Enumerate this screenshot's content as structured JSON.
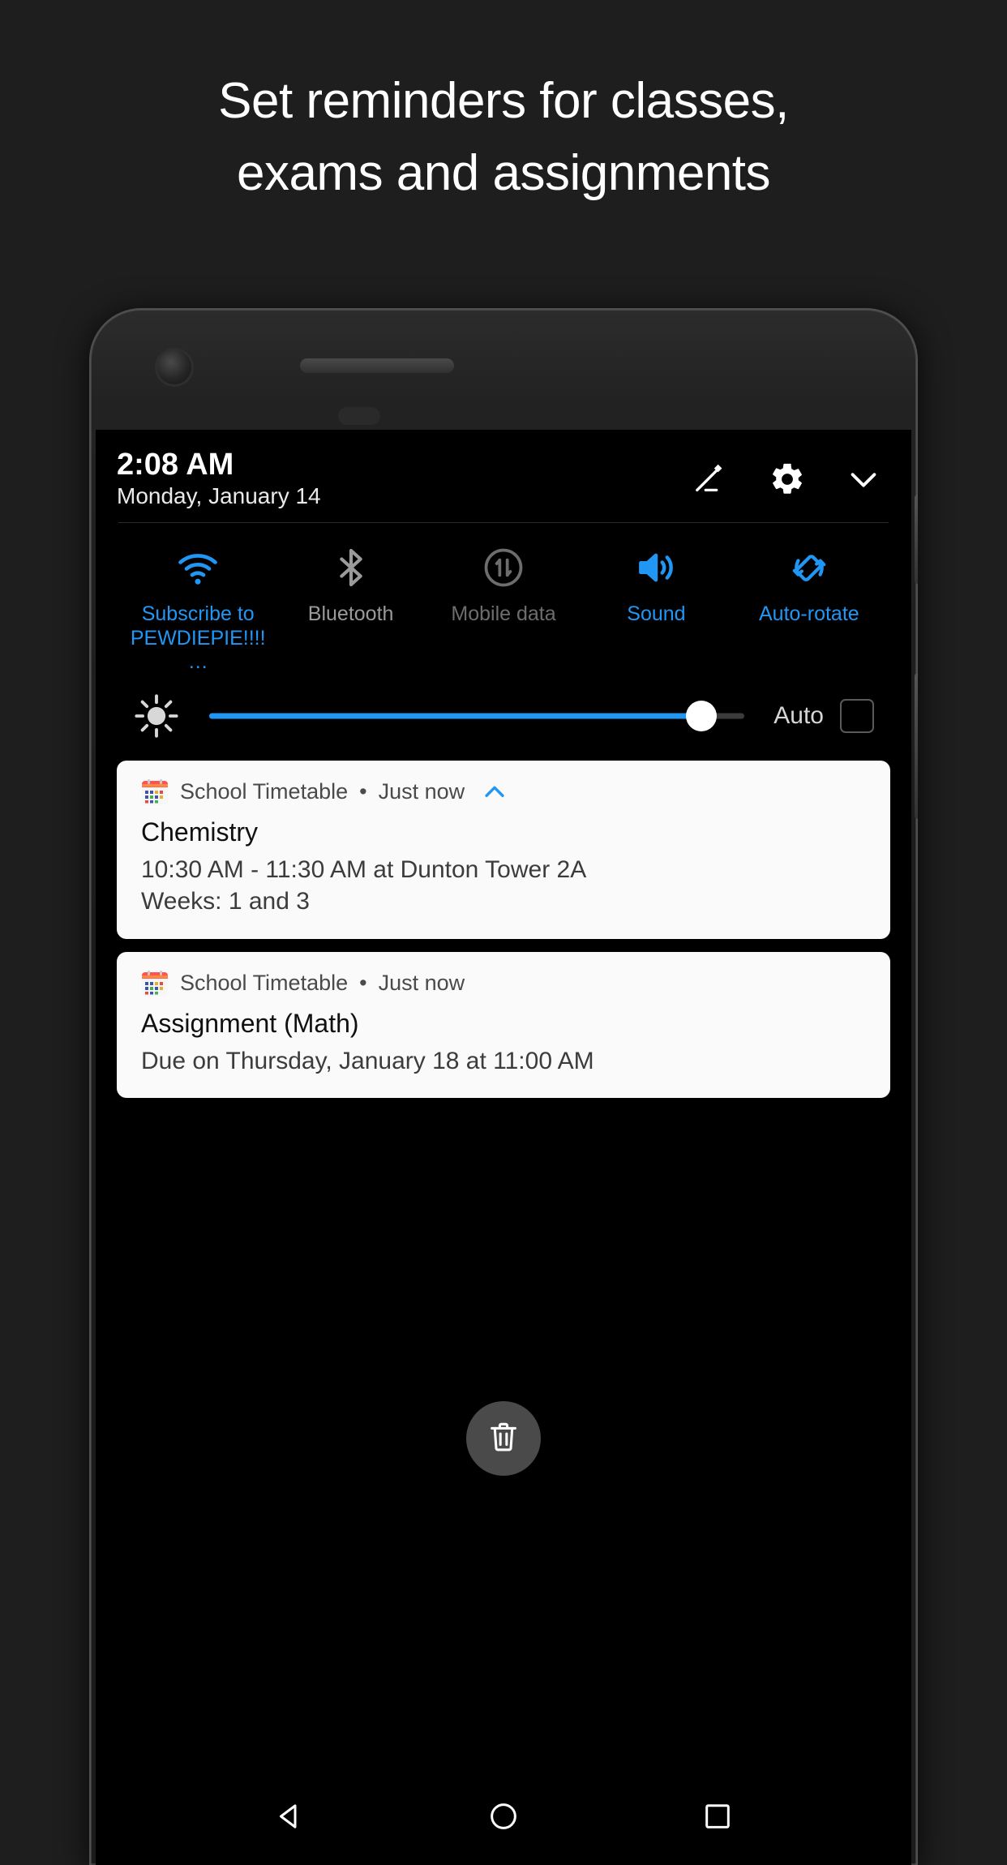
{
  "headline": {
    "line1": "Set reminders for classes,",
    "line2": "exams and assignments"
  },
  "colors": {
    "accent_blue": "#2196f3",
    "page_background": "#1e1e1e",
    "screen_background": "#000000",
    "notification_card": "#fafafa",
    "tile_off_text": "#9a9a9a"
  },
  "status_shade": {
    "time": "2:08 AM",
    "date": "Monday, January 14",
    "header_icons": [
      {
        "name": "edit-icon",
        "label": "Edit"
      },
      {
        "name": "gear-icon",
        "label": "Settings"
      },
      {
        "name": "chevron-down-icon",
        "label": "Collapse"
      }
    ]
  },
  "quick_settings": {
    "tiles": [
      {
        "icon": "wifi-icon",
        "label": "Subscribe to PEWDIEPIE!!!!…",
        "state": "on"
      },
      {
        "icon": "bluetooth-icon",
        "label": "Bluetooth",
        "state": "off"
      },
      {
        "icon": "mobile-data-icon",
        "label": "Mobile data",
        "state": "disabled"
      },
      {
        "icon": "sound-icon",
        "label": "Sound",
        "state": "on"
      },
      {
        "icon": "auto-rotate-icon",
        "label": "Auto-rotate",
        "state": "on"
      }
    ]
  },
  "brightness": {
    "icon": "brightness-sun-icon",
    "value_percent": 92,
    "auto_label": "Auto",
    "auto_checked": false
  },
  "notifications": [
    {
      "app_icon": "calendar-icon",
      "app_name": "School Timetable",
      "separator": "•",
      "time": "Just now",
      "expand_icon": "chevron-up-icon",
      "expanded": true,
      "title": "Chemistry",
      "lines": [
        "10:30 AM - 11:30 AM at Dunton Tower 2A",
        "Weeks: 1 and 3"
      ]
    },
    {
      "app_icon": "calendar-icon",
      "app_name": "School Timetable",
      "separator": "•",
      "time": "Just now",
      "expand_icon": null,
      "expanded": false,
      "title": "Assignment (Math)",
      "lines": [
        "Due on Thursday, January 18 at 11:00 AM"
      ]
    }
  ],
  "clear_all": {
    "icon": "trash-icon",
    "label": "Clear all notifications"
  },
  "nav_bar": {
    "buttons": [
      {
        "icon": "back-triangle-icon",
        "label": "Back"
      },
      {
        "icon": "home-circle-icon",
        "label": "Home"
      },
      {
        "icon": "recents-square-icon",
        "label": "Recents"
      }
    ]
  }
}
